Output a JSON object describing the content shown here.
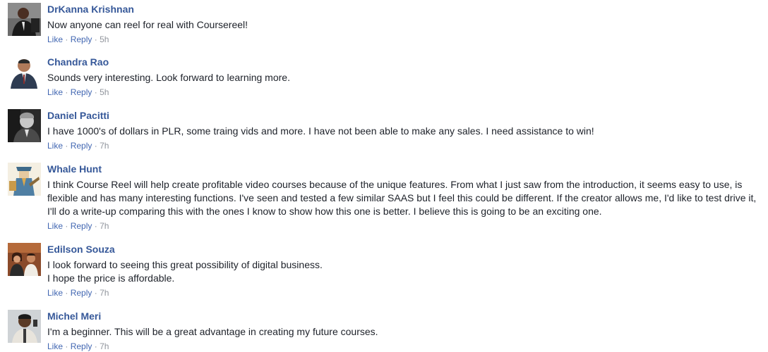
{
  "comments": [
    {
      "author": "DrKanna Krishnan",
      "lines": [
        "Now anyone can reel for real with Coursereel!"
      ],
      "like_label": "Like",
      "reply_label": "Reply",
      "separator": "·",
      "time": "5h"
    },
    {
      "author": "Chandra Rao",
      "lines": [
        "Sounds very interesting. Look forward to learning more."
      ],
      "like_label": "Like",
      "reply_label": "Reply",
      "separator": "·",
      "time": "5h"
    },
    {
      "author": "Daniel Pacitti",
      "lines": [
        "I have 1000's of dollars in PLR, some traing vids and more. I have not been able to make any sales. I need assistance to win!"
      ],
      "like_label": "Like",
      "reply_label": "Reply",
      "separator": "·",
      "time": "7h"
    },
    {
      "author": "Whale Hunt",
      "lines": [
        "I think Course Reel will help create profitable video courses because of the unique features. From what I just saw from the introduction, it seems easy to use, is",
        "flexible and has many interesting functions. I've seen and tested a few similar SAAS but I feel this could be different. If the creator allows me, I'd like to test drive it,",
        "I'll do a write-up comparing this with the ones I know to show how this one is better. I believe this is going to be an exciting one."
      ],
      "like_label": "Like",
      "reply_label": "Reply",
      "separator": "·",
      "time": "7h"
    },
    {
      "author": "Edilson Souza",
      "lines": [
        "I look forward to seeing this great possibility of digital business.",
        "I hope the price is affordable."
      ],
      "like_label": "Like",
      "reply_label": "Reply",
      "separator": "·",
      "time": "7h"
    },
    {
      "author": "Michel Meri",
      "lines": [
        "I'm a beginner. This will be a great advantage in creating my future courses."
      ],
      "like_label": "Like",
      "reply_label": "Reply",
      "separator": "·",
      "time": "7h"
    }
  ],
  "colors": {
    "author_link": "#365899",
    "action_link": "#4267b2",
    "meta_text": "#90949c",
    "body_text": "#1d2129"
  },
  "icons": [
    "profile-photo-drkanna",
    "profile-photo-chandra",
    "profile-photo-daniel",
    "profile-photo-whale",
    "profile-photo-edilson",
    "profile-photo-michel"
  ]
}
